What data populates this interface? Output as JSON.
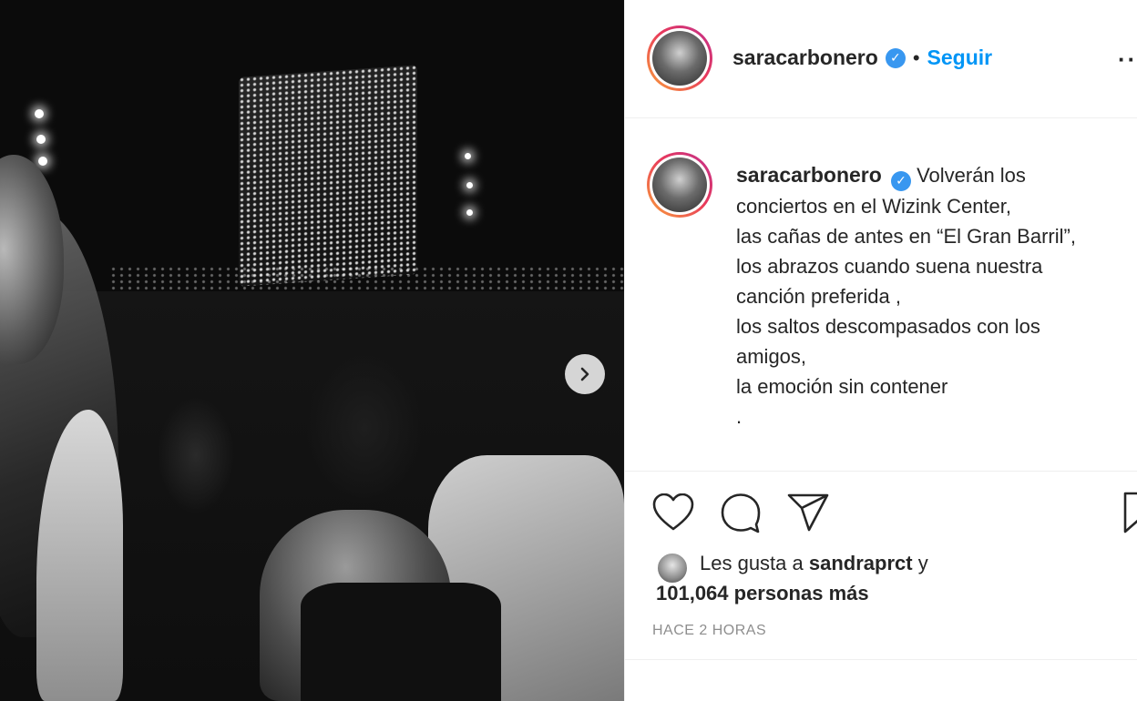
{
  "post": {
    "username": "saracarbonero",
    "follow_label": "Seguir",
    "separator": "•",
    "more_label": "···",
    "verified_glyph": "✓",
    "caption_lines": [
      "Volverán los",
      "conciertos en el Wizink Center,",
      "las cañas de antes en “El Gran Barril”,",
      "los abrazos cuando suena nuestra",
      "canción preferida ,",
      "los saltos descompasados con los",
      "amigos,",
      "la emoción sin contener",
      "."
    ],
    "likes": {
      "prefix": "Les gusta a",
      "liker": "sandraprct",
      "conj": "y",
      "count": "101,064 personas más"
    },
    "timestamp": "HACE 2 HORAS"
  },
  "icons": {
    "like": "heart-icon",
    "comment": "comment-icon",
    "share": "share-icon",
    "save": "bookmark-icon",
    "next": "chevron-right-icon"
  },
  "colors": {
    "accent": "#0095f6",
    "verified": "#3897f0",
    "muted": "#8e8e8e"
  }
}
